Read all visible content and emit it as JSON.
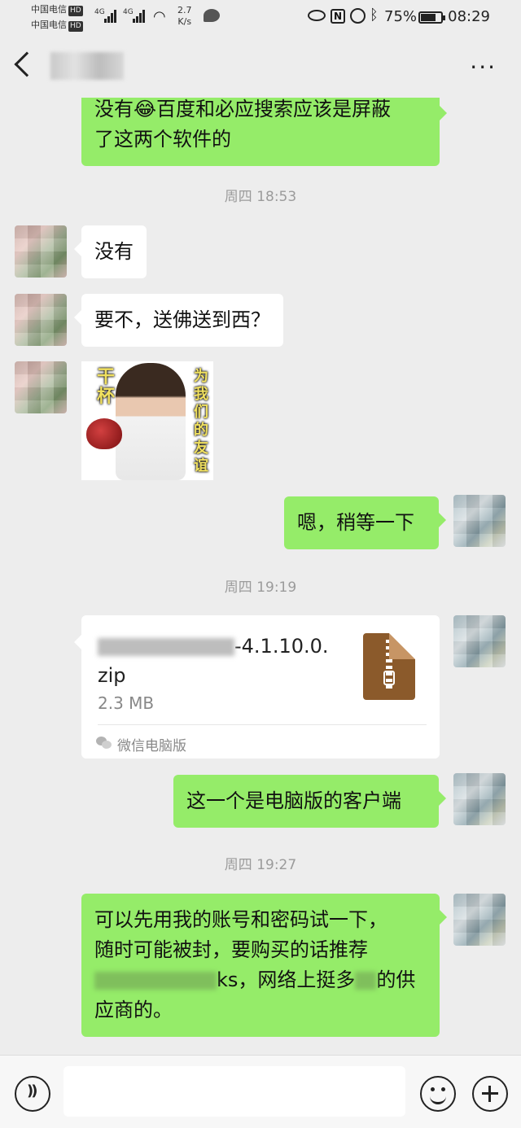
{
  "status_bar": {
    "carrier1": "中国电信",
    "carrier2": "中国电信",
    "hd": "HD",
    "net_type1": "4G",
    "net_type2": "4G",
    "speed_value": "2.7",
    "speed_unit": "K/s",
    "battery": "75%",
    "time": "08:29",
    "icons": [
      "eye-icon",
      "nfc-icon",
      "alarm-icon",
      "bluetooth-icon"
    ]
  },
  "nav": {
    "back_icon": "chevron-left-icon",
    "more_label": "···"
  },
  "messages": {
    "m1_line1": "没有😂百度和必应搜索应该是屏蔽",
    "m1_line2": "了这两个软件的",
    "ts1": "周四 18:53",
    "m2": "没有",
    "m3": "要不，送佛送到西？",
    "sticker_cap1": "干杯",
    "sticker_cap2": "为我们的友谊",
    "m4": "嗯，稍等一下",
    "ts2": "周四 19:19",
    "file_name_visible": "-4.1.10.0.",
    "file_name_line2": "zip",
    "file_size": "2.3 MB",
    "file_source": "微信电脑版",
    "m5": "这一个是电脑版的客户端",
    "ts3": "周四 19:27",
    "m6_line1": "可以先用我的账号和密码试一下，",
    "m6_line2": "随时可能被封，要购买的话推荐",
    "m6_line3a": "ks，网络上挺多",
    "m6_line3b": "的供",
    "m6_line4": "应商的。"
  },
  "input": {
    "placeholder": "",
    "voice_icon": "voice-icon",
    "emoji_icon": "emoji-icon",
    "plus_icon": "plus-icon"
  },
  "colors": {
    "background": "#ededed",
    "outgoing_bubble": "#95ec69",
    "incoming_bubble": "#ffffff",
    "timestamp": "#9b9b9b",
    "file_icon": "#8b5a2b"
  }
}
